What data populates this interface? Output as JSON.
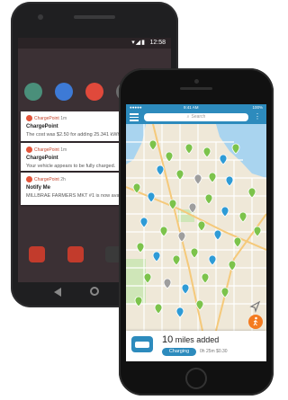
{
  "android": {
    "status": {
      "time": "12:58"
    },
    "notifications": [
      {
        "app": "ChargePoint",
        "age": "1m",
        "title": "ChargePoint",
        "body": "The cost was $2.50 for adding 25.341 kWh."
      },
      {
        "app": "ChargePoint",
        "age": "1m",
        "title": "ChargePoint",
        "body": "Your vehicle appears to be fully charged."
      },
      {
        "app": "ChargePoint",
        "age": "2h",
        "title": "Notify Me",
        "body": "MILLBRAE FARMERS MKT #1 is now avail"
      }
    ]
  },
  "iphone": {
    "status": {
      "carrier": "●●●●● ",
      "time": "9:41 AM",
      "battery": "100%"
    },
    "search_placeholder": "Search",
    "more": "⋮",
    "panel": {
      "miles_value": "10",
      "miles_suffix": "miles added",
      "charging_label": "Charging",
      "stats": "0h 25m   $0.30"
    }
  },
  "colors": {
    "brand_blue": "#2d8bbd",
    "station_green": "#7cc34b",
    "station_blue": "#2e9bd6",
    "station_gray": "#9e9e9e",
    "fab_orange": "#f47b20"
  },
  "icons": [
    "menu-icon",
    "search-icon",
    "more-icon",
    "locate-icon",
    "car-icon",
    "walker-icon",
    "station-pin-icon"
  ]
}
